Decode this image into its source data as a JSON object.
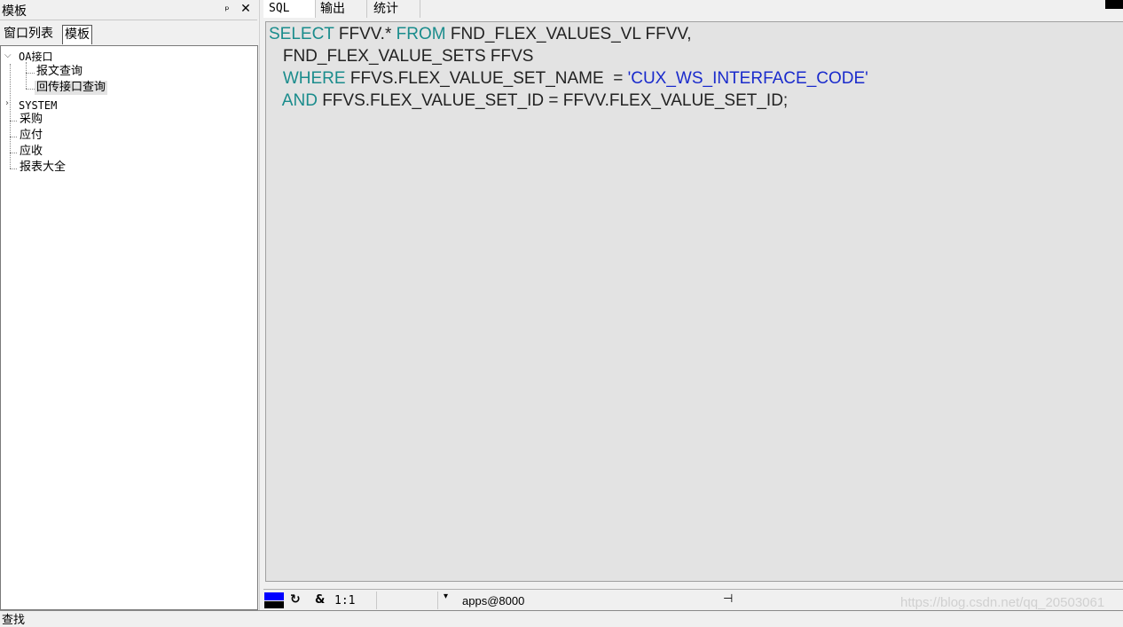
{
  "left_panel": {
    "title": "模板",
    "pin_glyph": "ᵖ",
    "close_glyph": "✕",
    "tabs": [
      "窗口列表",
      "模板"
    ],
    "tree": {
      "oa": "OA接口",
      "oa_children": [
        "报文查询",
        "回传接口查询"
      ],
      "system": "SYSTEM",
      "purchase": "采购",
      "payable": "应付",
      "receivable": "应收",
      "reports": "报表大全"
    }
  },
  "right_panel": {
    "tabs": [
      "SQL",
      "输出",
      "统计"
    ],
    "sql": {
      "line1_kw1": "SELECT",
      "line1_a": " FFVV.* ",
      "line1_kw2": "FROM",
      "line1_b": " FND_FLEX_VALUES_VL FFVV,",
      "line2": "   FND_FLEX_VALUE_SETS FFVS",
      "line3_kw": "WHERE",
      "line3_a": " FFVS.FLEX_VALUE_SET_NAME  = ",
      "line3_str": "'CUX_WS_INTERFACE_CODE'",
      "line4_kw": "AND",
      "line4_a": " FFVS.FLEX_VALUE_SET_ID = FFVV.FLEX_VALUE_SET_ID;"
    }
  },
  "statusbar": {
    "colors": {
      "top": "#0000ff",
      "bottom": "#000000"
    },
    "refresh_glyph": "↻",
    "amp": "&",
    "cursor": "1:1",
    "dropdown_glyph": "▾",
    "connection": "apps@8000",
    "pin_glyph": "⊣",
    "watermark": "https://blog.csdn.net/qq_20503061"
  },
  "bottom": {
    "find_label": "查找"
  },
  "colors": {
    "keyword": "#1a8c8c",
    "string": "#1a2bcc",
    "editor_bg": "#e3e3e3"
  }
}
